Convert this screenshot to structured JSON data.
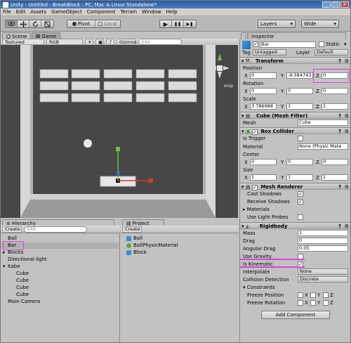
{
  "window": {
    "title": "Unity - Untitled - BreakBlock - PC, Mac & Linux Standalone*",
    "min": "_",
    "max": "□",
    "close": "×"
  },
  "menu": [
    "File",
    "Edit",
    "Assets",
    "GameObject",
    "Component",
    "Terrain",
    "Window",
    "Help"
  ],
  "toolbar": {
    "tools": [
      "hand",
      "move",
      "rotate",
      "scale"
    ],
    "pivot": "Pivot",
    "local": "Local",
    "play": "▶",
    "pause": "❚❚",
    "step": "▶❚",
    "layers": "Layers",
    "layout": "Wide"
  },
  "scene": {
    "tab_scene": "Scene",
    "tab_game": "Game",
    "shading": "Textured",
    "render": "RGB",
    "gizmos": "Gizmos",
    "search_placeholder": "All",
    "persp": "ersp"
  },
  "hierarchy": {
    "tab": "Hierarchy",
    "create": "Create",
    "search_placeholder": "All",
    "items": [
      {
        "label": "Ball",
        "indent": 0
      },
      {
        "label": "Bar",
        "indent": 0,
        "selected": true
      },
      {
        "label": "Blocks",
        "indent": 0,
        "arrow": true
      },
      {
        "label": "Directional light",
        "indent": 0
      },
      {
        "label": "Kabe",
        "indent": 0,
        "arrow": true,
        "open": true
      },
      {
        "label": "Cube",
        "indent": 1
      },
      {
        "label": "Cube",
        "indent": 1
      },
      {
        "label": "Cube",
        "indent": 1
      },
      {
        "label": "Cube",
        "indent": 1
      },
      {
        "label": "Main Camera",
        "indent": 0
      }
    ]
  },
  "project": {
    "tab": "Project",
    "create": "Create",
    "items": [
      {
        "label": "Ball",
        "icon": "cube-icon"
      },
      {
        "label": "BallPhysicMaterial",
        "icon": "physic-material-icon"
      },
      {
        "label": "Block",
        "icon": "cube-icon"
      }
    ]
  },
  "inspector": {
    "tab": "Inspector",
    "object_name": "Bar",
    "static_label": "Static",
    "tag_label": "Tag",
    "tag": "Untagged",
    "layer_label": "Layer",
    "layer": "Default",
    "transform": {
      "title": "Transform",
      "position_label": "Position",
      "position": {
        "x": "0",
        "y": "-9.384743",
        "z": "0"
      },
      "rotation_label": "Rotation",
      "rotation": {
        "x": "0",
        "y": "0",
        "z": "0"
      },
      "scale_label": "Scale",
      "scale": {
        "x": "3.786988",
        "y": "1",
        "z": "1"
      }
    },
    "mesh_filter": {
      "title": "Cube (Mesh Filter)",
      "mesh_label": "Mesh",
      "mesh": "Cube"
    },
    "box_collider": {
      "title": "Box Collider",
      "is_trigger_label": "Is Trigger",
      "material_label": "Material",
      "material": "None (Physic Mate",
      "center_label": "Center",
      "center": {
        "x": "0",
        "y": "0",
        "z": "0"
      },
      "size_label": "Size",
      "size": {
        "x": "1",
        "y": "1",
        "z": "1"
      }
    },
    "mesh_renderer": {
      "title": "Mesh Renderer",
      "cast_shadows": "Cast Shadows",
      "receive_shadows": "Receive Shadows",
      "materials": "Materials",
      "use_light_probes": "Use Light Probes"
    },
    "rigidbody": {
      "title": "Rigidbody",
      "mass_label": "Mass",
      "mass": "1",
      "drag_label": "Drag",
      "drag": "0",
      "angular_drag_label": "Angular Drag",
      "angular_drag": "0.05",
      "use_gravity": "Use Gravity",
      "is_kinematic": "Is Kinematic",
      "interpolate_label": "Interpolate",
      "interpolate": "None",
      "collision_label": "Collision Detection",
      "collision": "Discrete",
      "constraints": "Constraints",
      "freeze_position": "Freeze Position",
      "freeze_rotation": "Freeze Rotation",
      "x": "X",
      "y": "Y",
      "z": "Z"
    },
    "add_component": "Add Component"
  },
  "axis": {
    "x": "X",
    "y": "Y",
    "z": "Z"
  },
  "colors": {
    "highlight": "#e040d8",
    "selection": "#b0b0b0"
  }
}
